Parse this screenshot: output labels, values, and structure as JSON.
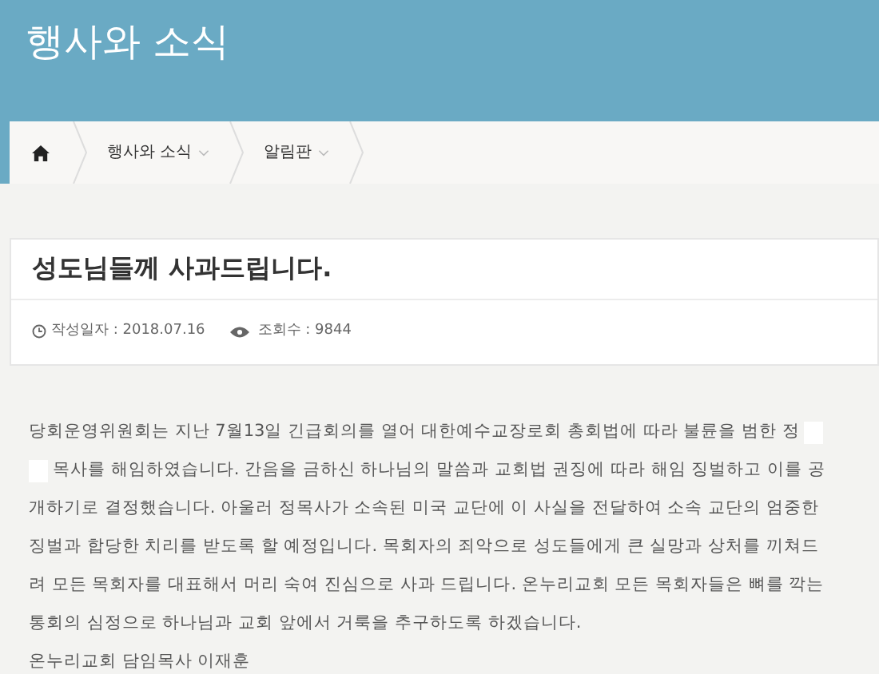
{
  "header": {
    "title": "행사와 소식"
  },
  "breadcrumb": [
    {
      "label": "행사와 소식",
      "dropdown": true
    },
    {
      "label": "알림판",
      "dropdown": true
    }
  ],
  "post": {
    "title": "성도님들께 사과드립니다.",
    "date": "작성일자 : 2018.07.16",
    "views": "조회수 : 9844"
  },
  "body": [
    {
      "text": "당회운영위원회는 지난 7월13일 긴급회의를 열어 대한예수교장로회 총회법에 따라 불륜을 범한 정",
      "kind": "redactedend"
    },
    {
      "text": "목사를 해임하였습니다. 간음을 금하신 하나님의 말씀과 교회법 권징에 따라 해임 징벌하고 이를 공",
      "kind": "redactedstart"
    },
    {
      "text": "개하기로 결정했습니다. 아울러 정목사가 소속된 미국 교단에 이 사실을 전달하여 소속 교단의 엄중한",
      "kind": "plain"
    },
    {
      "text": "징벌과 합당한 치리를 받도록 할 예정입니다. 목회자의 죄악으로 성도들에게 큰 실망과 상처를 끼쳐드",
      "kind": "plain"
    },
    {
      "text": "려 모든 목회자를 대표해서 머리 숙여 진심으로 사과 드립니다. 온누리교회 모든 목회자들은 뼈를 깍는",
      "kind": "plain"
    },
    {
      "text": "통회의 심정으로 하나님과 교회 앞에서 거룩을 추구하도록 하겠습니다.",
      "kind": "plain"
    },
    {
      "text": "온누리교회 담임목사 이재훈",
      "kind": "plain"
    }
  ]
}
